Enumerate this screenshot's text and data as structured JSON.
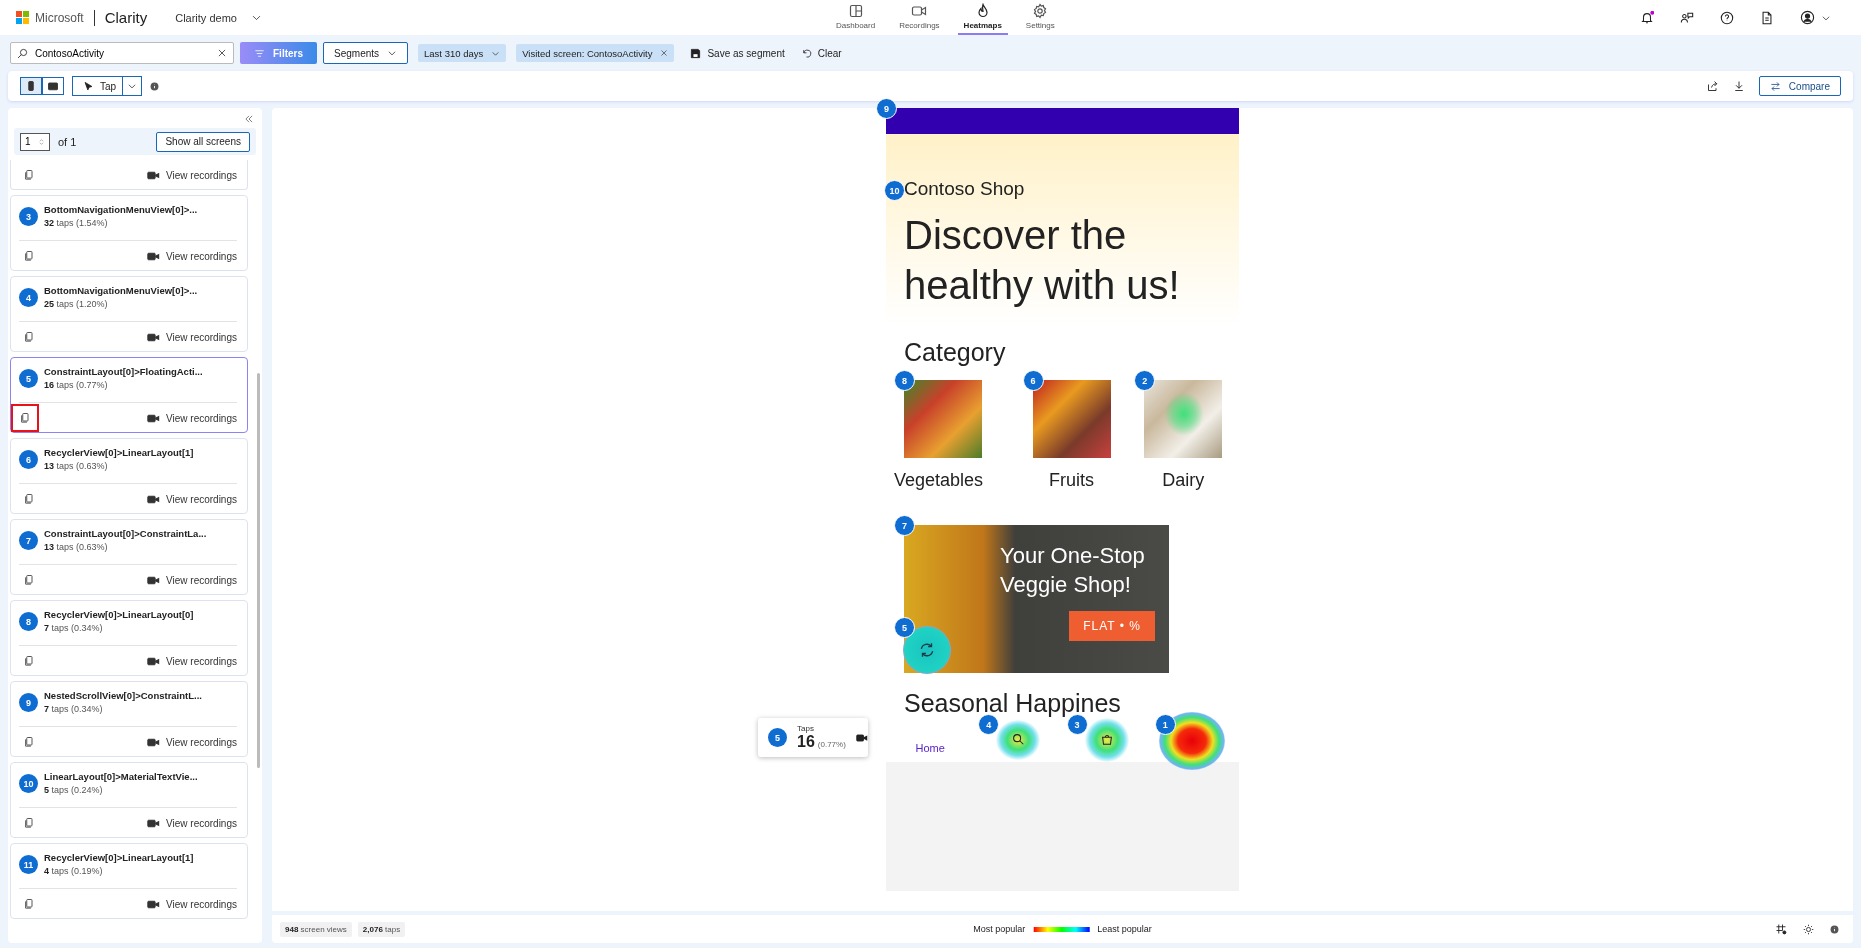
{
  "brand": {
    "company": "Microsoft",
    "product": "Clarity",
    "project": "Clarity demo"
  },
  "nav_tabs": [
    {
      "label": "Dashboard",
      "kind": "dashboard",
      "selected": false
    },
    {
      "label": "Recordings",
      "kind": "recordings",
      "selected": false
    },
    {
      "label": "Heatmaps",
      "kind": "heatmaps",
      "selected": true
    },
    {
      "label": "Settings",
      "kind": "settings",
      "selected": false
    }
  ],
  "filter_bar": {
    "search": "ContosoActivity",
    "filters": "Filters",
    "segments": "Segments",
    "chips": [
      {
        "label": "Last 310 days",
        "kind": "dropdown"
      },
      {
        "label": "Visited screen: ContosoActivity",
        "kind": "removable"
      }
    ],
    "save": "Save as segment",
    "clear": "Clear"
  },
  "toolbar": {
    "devices": [
      {
        "kind": "phone",
        "selected": true
      },
      {
        "kind": "tablet",
        "selected": false
      }
    ],
    "action": "Tap",
    "compare": "Compare"
  },
  "sidebar": {
    "page": "1",
    "page_of": "of 1",
    "show_all": "Show all screens",
    "items": [
      {
        "kind": "partial",
        "action": "View recordings",
        "selected": false,
        "annotated": false
      },
      {
        "kind": "full",
        "number": "3",
        "title": "BottomNavigationMenuView[0]>...",
        "taps": "**32** taps (1.54%)",
        "action": "View recordings",
        "selected": false,
        "annotated": false
      },
      {
        "kind": "full",
        "number": "4",
        "title": "BottomNavigationMenuView[0]>...",
        "taps": "**25** taps (1.20%)",
        "action": "View recordings",
        "selected": false,
        "annotated": false
      },
      {
        "kind": "full",
        "number": "5",
        "title": "ConstraintLayout[0]>FloatingActi...",
        "taps": "**16** taps (0.77%)",
        "action": "View recordings",
        "selected": true,
        "annotated": true
      },
      {
        "kind": "full",
        "number": "6",
        "title": "RecyclerView[0]>LinearLayout[1]",
        "taps": "**13** taps (0.63%)",
        "action": "View recordings",
        "selected": false,
        "annotated": false
      },
      {
        "kind": "full",
        "number": "7",
        "title": "ConstraintLayout[0]>ConstraintLa...",
        "taps": "**13** taps (0.63%)",
        "action": "View recordings",
        "selected": false,
        "annotated": false
      },
      {
        "kind": "full",
        "number": "8",
        "title": "RecyclerView[0]>LinearLayout[0]",
        "taps": "**7** taps (0.34%)",
        "action": "View recordings",
        "selected": false,
        "annotated": false
      },
      {
        "kind": "full",
        "number": "9",
        "title": "NestedScrollView[0]>ConstraintL...",
        "taps": "**7** taps (0.34%)",
        "action": "View recordings",
        "selected": false,
        "annotated": false
      },
      {
        "kind": "full",
        "number": "10",
        "title": "LinearLayout[0]>MaterialTextVie...",
        "taps": "**5** taps (0.24%)",
        "action": "View recordings",
        "selected": false,
        "annotated": false
      },
      {
        "kind": "full",
        "number": "11",
        "title": "RecyclerView[0]>LinearLayout[1]",
        "taps": "**4** taps (0.19%)",
        "action": "View recordings",
        "selected": false,
        "annotated": false
      }
    ]
  },
  "screen": {
    "top_marker": "9",
    "shop_name": "Contoso Shop",
    "headline_marker": "10",
    "headline": "Discover the healthy with us!",
    "category_title": "Category",
    "categories": [
      {
        "label": "Vegetables",
        "marker": "8",
        "kind": "vegetables"
      },
      {
        "label": "Fruits",
        "marker": "6",
        "kind": "fruits"
      },
      {
        "label": "Dairy",
        "marker": "2",
        "kind": "dairy"
      }
    ],
    "banner": {
      "marker": "7",
      "title": "Your One-Stop Veggie Shop!",
      "button": "FLAT • %"
    },
    "fab_marker": "5",
    "section_title": "Seasonal Happines",
    "nav_items": [
      {
        "kind": "home",
        "label": "Home"
      },
      {
        "kind": "search",
        "marker": "4"
      },
      {
        "kind": "cart",
        "marker": "3"
      },
      {
        "kind": "profile",
        "marker": "1"
      }
    ]
  },
  "tooltip": {
    "number": "5",
    "label": "Taps",
    "count": "16",
    "percent": "(0.77%)"
  },
  "footer": {
    "views": "**948** screen views",
    "taps": "**2,076** taps",
    "most": "Most popular",
    "least": "Least popular"
  }
}
